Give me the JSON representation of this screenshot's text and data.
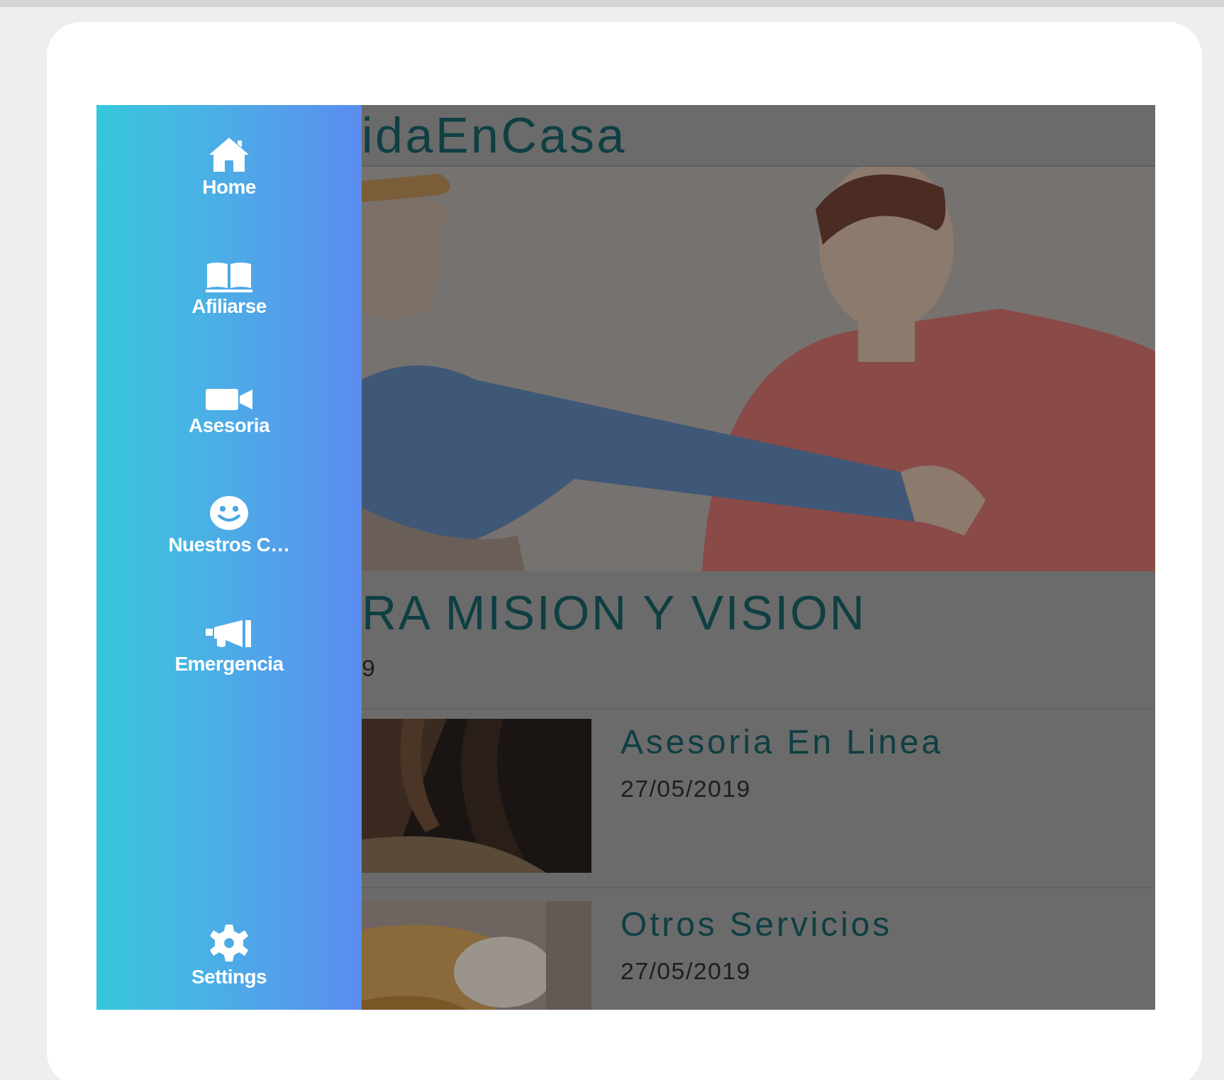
{
  "drawer": {
    "items": [
      {
        "kind": "home",
        "label": "Home"
      },
      {
        "kind": "book",
        "label": "Afiliarse"
      },
      {
        "kind": "video",
        "label": "Asesoria"
      },
      {
        "kind": "smiley",
        "label": "Nuestros C…"
      },
      {
        "kind": "megaphone",
        "label": "Emergencia"
      }
    ],
    "footer": {
      "kind": "gear",
      "label": "Settings"
    }
  },
  "app": {
    "title": "idaEnCasa"
  },
  "featured": {
    "title": "RA MISION Y VISION",
    "date": "9"
  },
  "posts": [
    {
      "title": "Asesoria En Linea",
      "date": "27/05/2019",
      "kind": "picture"
    },
    {
      "title": "Otros Servicios",
      "date": "27/05/2019",
      "kind": "picture"
    }
  ]
}
